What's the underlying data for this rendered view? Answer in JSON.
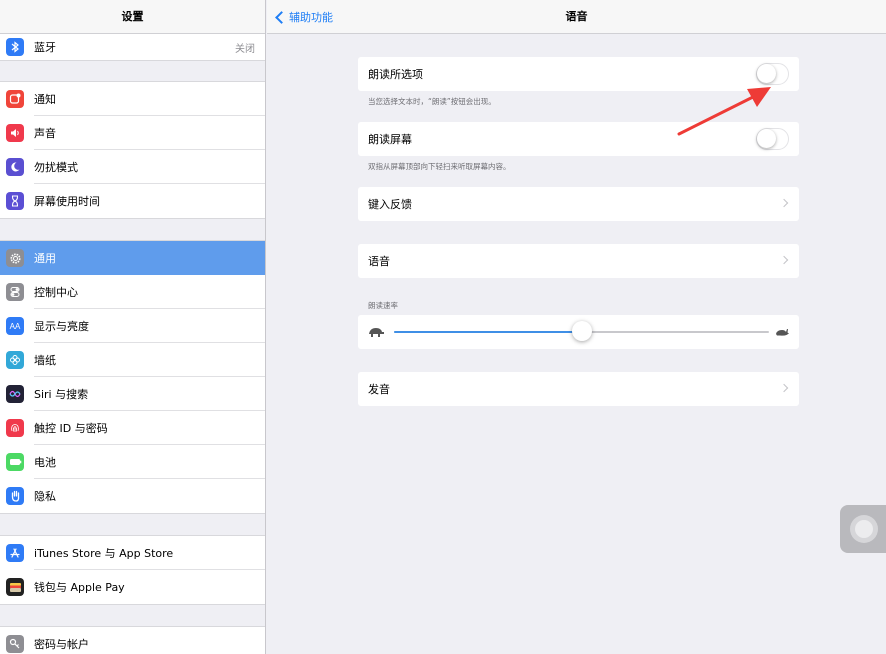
{
  "sidebar": {
    "title": "设置",
    "items": [
      {
        "label": "蓝牙",
        "value": "关闭",
        "icon": "bluetooth-icon",
        "color": "#2f7bf6"
      },
      {
        "label": "通知",
        "icon": "notifications-icon",
        "color": "#f0453a"
      },
      {
        "label": "声音",
        "icon": "sounds-icon",
        "color": "#f0394c"
      },
      {
        "label": "勿扰模式",
        "icon": "moon-icon",
        "color": "#5a4fd1"
      },
      {
        "label": "屏幕使用时间",
        "icon": "hourglass-icon",
        "color": "#5b4fd4"
      },
      {
        "label": "通用",
        "icon": "gear-icon",
        "color": "#8e8e93",
        "active": true
      },
      {
        "label": "控制中心",
        "icon": "toggles-icon",
        "color": "#8e8e93"
      },
      {
        "label": "显示与亮度",
        "icon": "text-size-icon",
        "color": "#2f7bf6"
      },
      {
        "label": "墙纸",
        "icon": "flower-icon",
        "color": "#32a8d8"
      },
      {
        "label": "Siri 与搜索",
        "icon": "siri-icon",
        "color": "#222236"
      },
      {
        "label": "触控 ID 与密码",
        "icon": "fingerprint-icon",
        "color": "#f0394c"
      },
      {
        "label": "电池",
        "icon": "battery-icon",
        "color": "#4cd964"
      },
      {
        "label": "隐私",
        "icon": "hand-icon",
        "color": "#2f7bf6"
      },
      {
        "label": "iTunes Store 与 App Store",
        "icon": "app-store-icon",
        "color": "#2f7bf6"
      },
      {
        "label": "钱包与 Apple Pay",
        "icon": "wallet-icon",
        "color": "#222"
      },
      {
        "label": "密码与帐户",
        "icon": "key-icon",
        "color": "#8e8e93"
      }
    ]
  },
  "nav": {
    "back_label": "辅助功能",
    "title": "语音"
  },
  "speech": {
    "speak_selection": {
      "label": "朗读所选项",
      "footnote": "当您选择文本时，“朗读”按钮会出现。",
      "on": false
    },
    "speak_screen": {
      "label": "朗读屏幕",
      "footnote": "双指从屏幕顶部向下轻扫来听取屏幕内容。",
      "on": false
    },
    "typing_feedback": {
      "label": "键入反馈"
    },
    "voices": {
      "label": "语音"
    },
    "rate": {
      "header": "朗读速率",
      "value": 0.5
    },
    "pronunciations": {
      "label": "发音"
    }
  },
  "colors": {
    "accent": "#1f7ef5",
    "active_row": "#5f9cec",
    "arrow": "#ee3b36"
  }
}
